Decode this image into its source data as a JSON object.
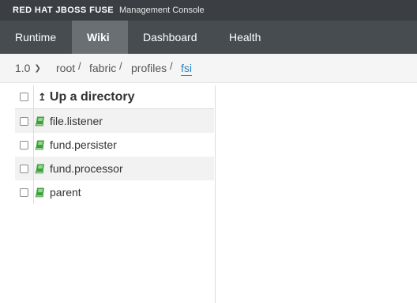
{
  "brand": {
    "logo": "RED HAT JBOSS FUSE",
    "subtitle": "Management Console"
  },
  "nav": {
    "tabs": [
      {
        "label": "Runtime",
        "active": false
      },
      {
        "label": "Wiki",
        "active": true
      },
      {
        "label": "Dashboard",
        "active": false
      },
      {
        "label": "Health",
        "active": false
      }
    ]
  },
  "breadcrumb": {
    "version": "1.0",
    "items": [
      "root",
      "fabric",
      "profiles",
      "fsi"
    ],
    "separator": "/"
  },
  "files": {
    "up_label": "Up a directory",
    "items": [
      {
        "name": "file.listener",
        "icon": "book-icon"
      },
      {
        "name": "fund.persister",
        "icon": "book-icon"
      },
      {
        "name": "fund.processor",
        "icon": "book-icon"
      },
      {
        "name": "parent",
        "icon": "book-icon"
      }
    ]
  },
  "colors": {
    "brandbar": "#3b3f43",
    "navbar": "#474c50",
    "active_tab": "#6a6f73",
    "link": "#2a82c3",
    "book_icon": "#3aa536"
  }
}
